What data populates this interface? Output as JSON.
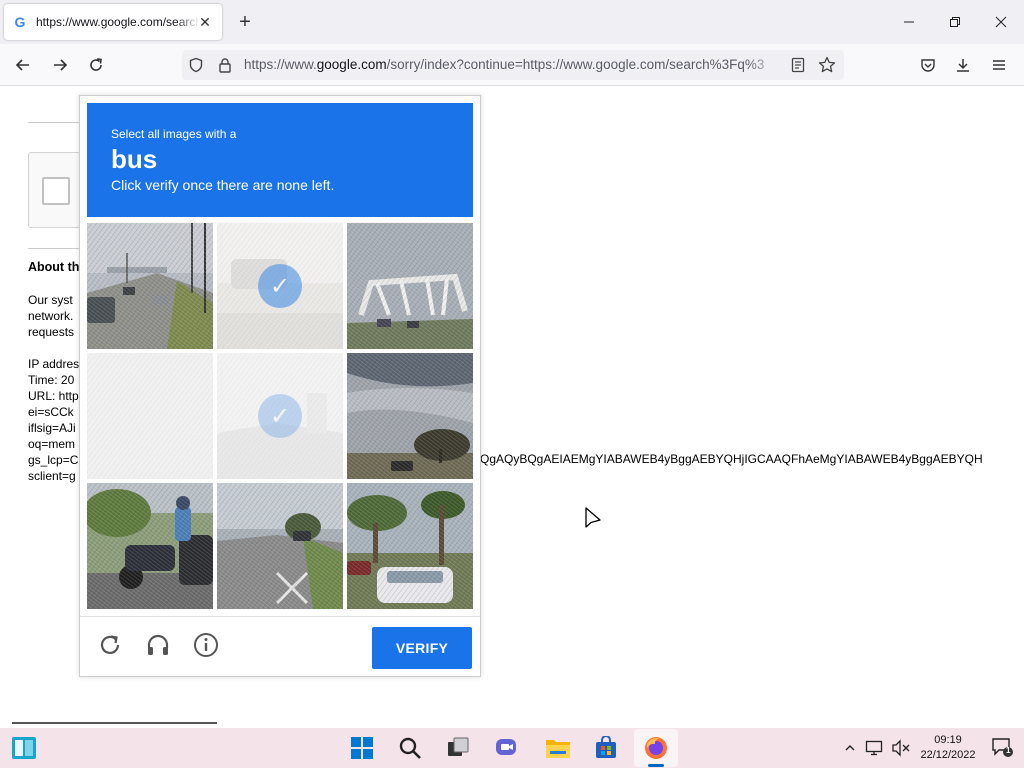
{
  "browser": {
    "tab_title": "https://www.google.com/search",
    "favicon_letter": "G",
    "tab_close_glyph": "✕",
    "new_tab_glyph": "+",
    "url_prefix": "https://www.",
    "url_host": "google.com",
    "url_rest": "/sorry/index?continue=https://www.google.com/search%3Fq%3",
    "window_controls": [
      "minimize-icon",
      "restore-icon",
      "close-icon"
    ]
  },
  "page": {
    "about_heading": "About th",
    "paragraph": [
      "Our syst",
      "network.",
      "requests"
    ],
    "details": [
      "IP addres",
      "Time: 20",
      "URL: http",
      "ei=sCCk",
      "iflsig=AJi",
      "oq=mem",
      "gs_lcp=C",
      "sclient=g"
    ],
    "gs_lcp_overflow": "QgAQyBQgAEIAEMgYIABAWEB4yBggAEBYQHjIGCAAQFhAeMgYIABAWEB4yBggAEBYQH"
  },
  "captcha": {
    "instruction_line1": "Select all images with a",
    "target": "bus",
    "instruction_line3": "Click verify once there are none left.",
    "verify_label": "VERIFY",
    "accent_color": "#1a73e8",
    "tiles": [
      {
        "desc": "street-with-cars",
        "state": "normal"
      },
      {
        "desc": "street-selected",
        "state": "selected"
      },
      {
        "desc": "bridge",
        "state": "normal"
      },
      {
        "desc": "blank-faded",
        "state": "faded"
      },
      {
        "desc": "street-selected-faded",
        "state": "selected"
      },
      {
        "desc": "trees-and-sky",
        "state": "normal"
      },
      {
        "desc": "motorcycle",
        "state": "normal"
      },
      {
        "desc": "road-with-crossing",
        "state": "normal"
      },
      {
        "desc": "palm-trees-and-cars",
        "state": "normal"
      }
    ],
    "footer_icons": [
      "reload-icon",
      "headphones-icon",
      "info-icon"
    ]
  },
  "taskbar": {
    "time": "09:19",
    "date": "22/12/2022",
    "notification_count": "1",
    "apps": [
      "widgets-icon",
      "start-icon",
      "search-icon",
      "task-view-icon",
      "chat-icon",
      "file-explorer-icon",
      "store-icon",
      "firefox-icon"
    ]
  }
}
